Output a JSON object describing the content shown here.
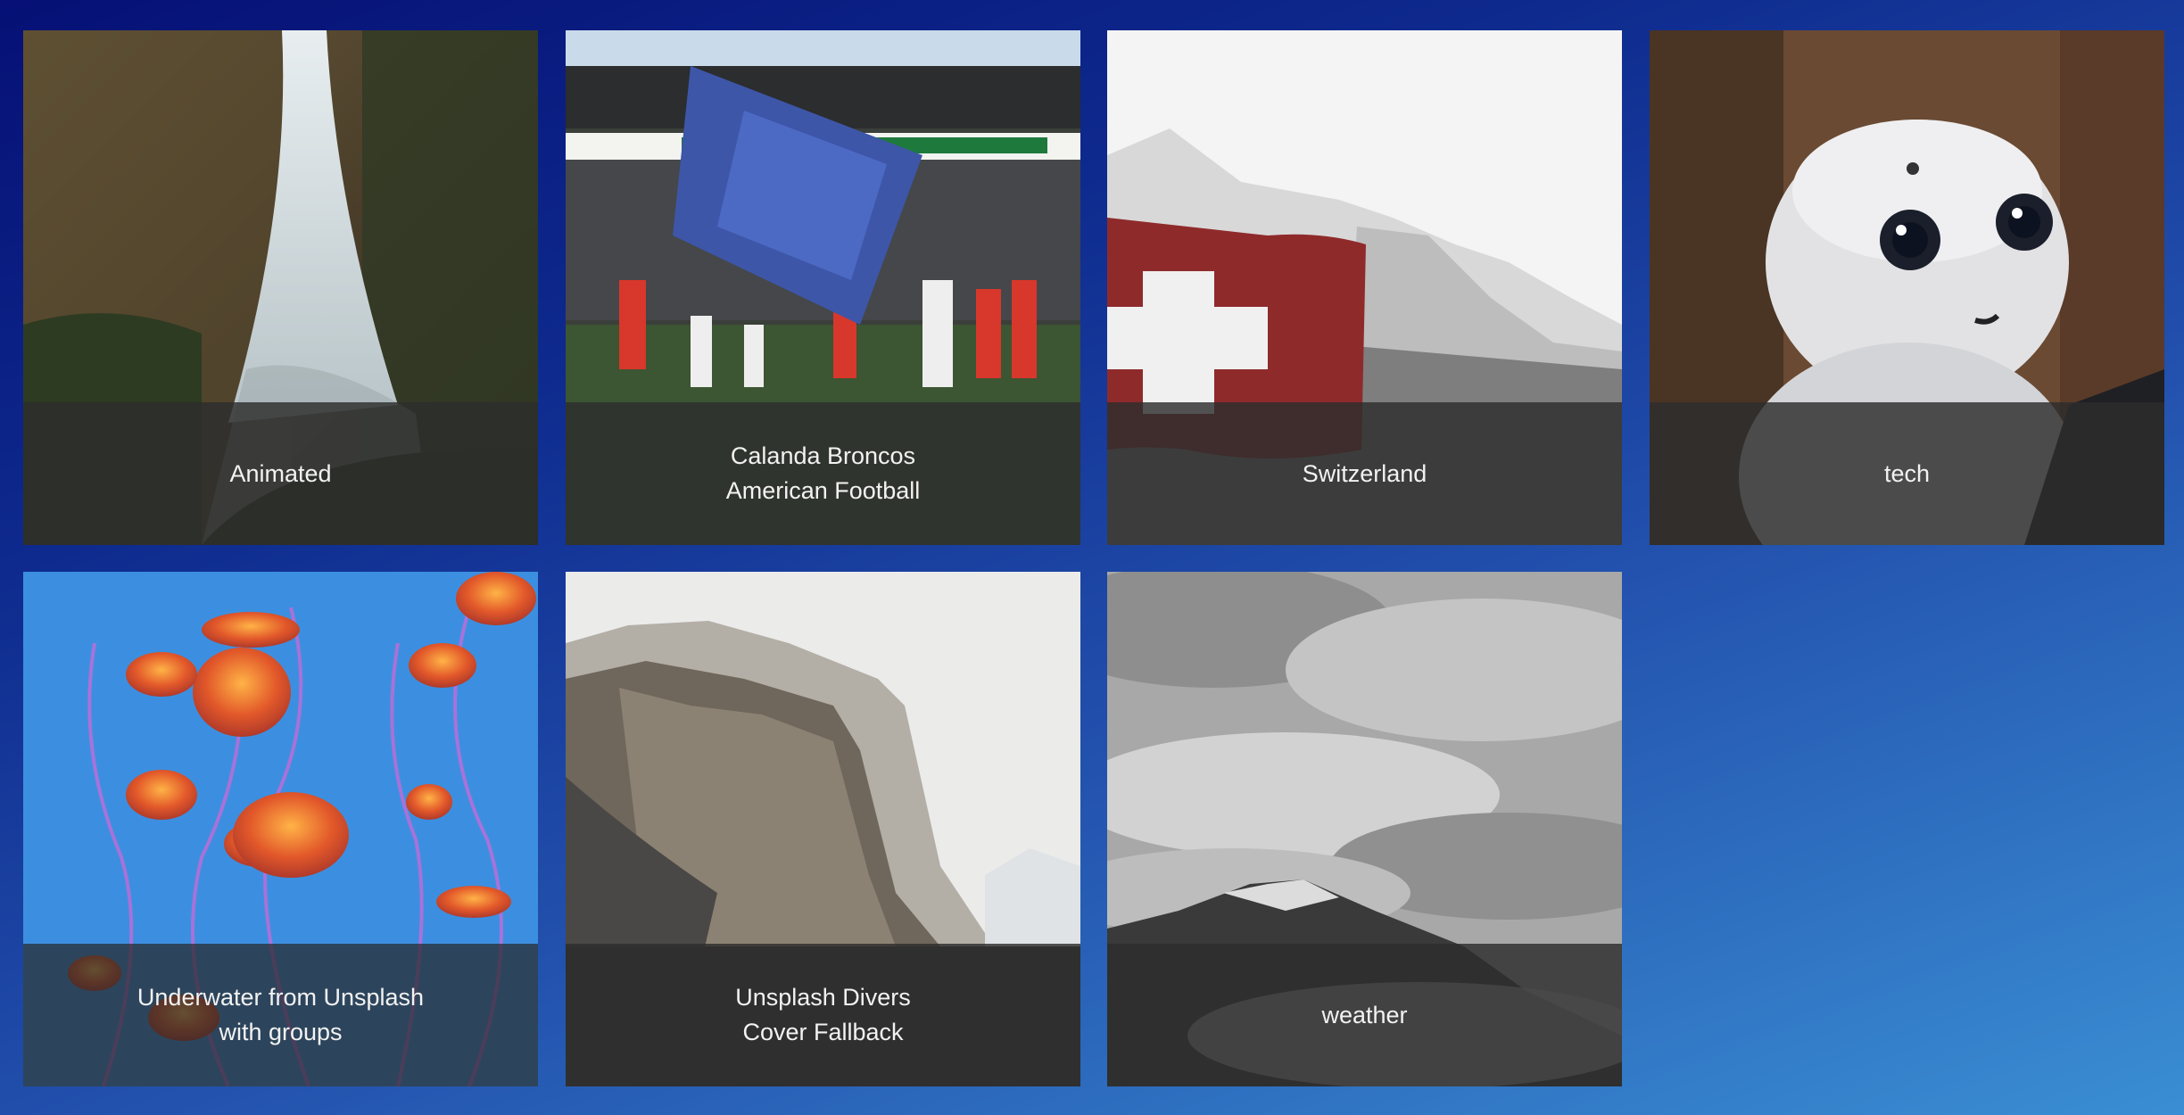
{
  "tiles": [
    {
      "label": "Animated",
      "image": "waterfall-cliff"
    },
    {
      "label": "Calanda Broncos\nAmerican Football",
      "image": "football-team-flag"
    },
    {
      "label": "Switzerland",
      "image": "swiss-flag-mountain"
    },
    {
      "label": "tech",
      "image": "robot"
    },
    {
      "label": "Underwater from Unsplash\nwith groups",
      "image": "jellyfish"
    },
    {
      "label": "Unsplash Divers\nCover Fallback",
      "image": "granite-cliff"
    },
    {
      "label": "weather",
      "image": "cloudy-mountain"
    }
  ],
  "colors": {
    "background_start": "#061075",
    "background_end": "#3a8ed3",
    "caption_bg": "#2d2d2d",
    "caption_text": "#f2f2f2"
  }
}
